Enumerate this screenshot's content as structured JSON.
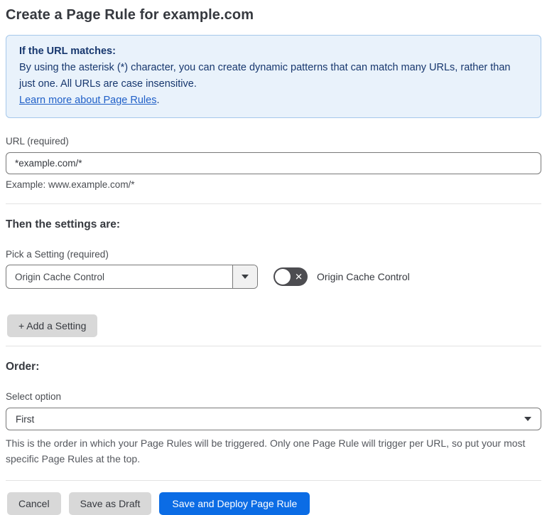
{
  "page": {
    "title": "Create a Page Rule for example.com"
  },
  "info_box": {
    "heading": "If the URL matches:",
    "body": "By using the asterisk (*) character, you can create dynamic patterns that can match many URLs, rather than just one. All URLs are case insensitive.",
    "link_label": "Learn more about Page Rules",
    "link_suffix": "."
  },
  "url_section": {
    "label": "URL (required)",
    "value": "*example.com/*",
    "example": "Example: www.example.com/*"
  },
  "settings_section": {
    "heading": "Then the settings are:",
    "picker_label": "Pick a Setting (required)",
    "picker_value": "Origin Cache Control",
    "toggle_label": "Origin Cache Control",
    "toggle_state": "off",
    "toggle_glyph": "✕",
    "add_button_label": "+ Add a Setting"
  },
  "order_section": {
    "heading": "Order:",
    "select_label": "Select option",
    "select_value": "First",
    "help_text": "This is the order in which your Page Rules will be triggered. Only one Page Rule will trigger per URL, so put your most specific Page Rules at the top."
  },
  "footer": {
    "cancel_label": "Cancel",
    "save_draft_label": "Save as Draft",
    "save_deploy_label": "Save and Deploy Page Rule"
  },
  "colors": {
    "info_bg": "#e9f2fb",
    "info_border": "#a6c8eb",
    "info_text": "#17376e",
    "link_blue": "#2060c8",
    "primary_button_blue": "#0b6ce5",
    "gray_button": "#d8d8d8",
    "toggle_off_gray": "#4d4d51"
  }
}
